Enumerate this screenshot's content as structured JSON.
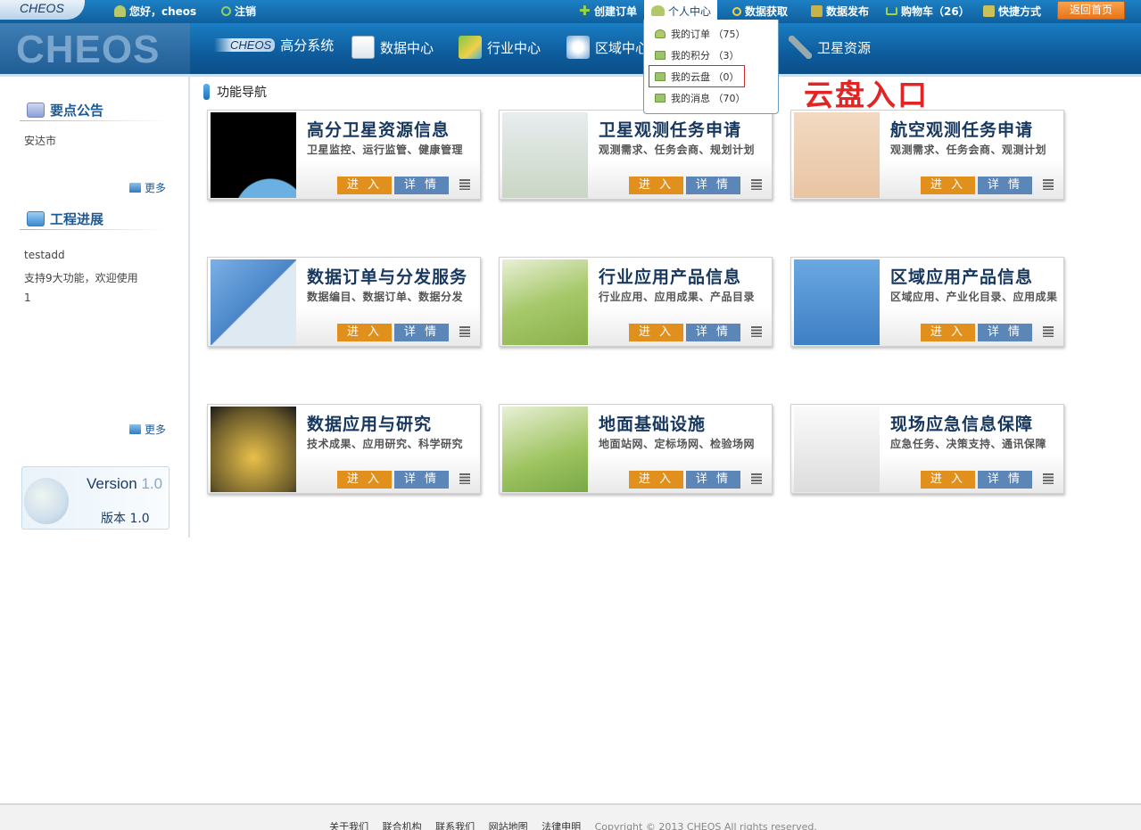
{
  "topbar": {
    "logo_small": "CHEOS",
    "greeting": "您好，cheos",
    "logout": "注销",
    "create_order": "创建订单",
    "personal_center": "个人中心",
    "data_get": "数据获取",
    "data_publish": "数据发布",
    "cart": "购物车（26）",
    "shortcut": "快捷方式",
    "home": "返回首页"
  },
  "header": {
    "logo": "CHEOS",
    "nav": [
      {
        "label": "高分系统",
        "prefix": "CHEOS"
      },
      {
        "label": "数据中心"
      },
      {
        "label": "行业中心"
      },
      {
        "label": "区域中心"
      },
      {
        "label": "卫星资源"
      }
    ]
  },
  "dropdown": {
    "items": [
      {
        "label": "我的订单 （75）"
      },
      {
        "label": "我的积分 （3）"
      },
      {
        "label": "我的云盘 （0）"
      },
      {
        "label": "我的消息 （70）"
      }
    ]
  },
  "annotation": "云盘入口",
  "sidebar": {
    "notice_title": "要点公告",
    "notice_items": [
      "安达市"
    ],
    "more1": "更多",
    "progress_title": "工程进展",
    "progress_items": [
      "testadd",
      "支持9大功能，欢迎使用",
      "1"
    ],
    "more2": "更多",
    "version_label": "Version",
    "version_num": "1.0",
    "version_cn": "版本  1.0"
  },
  "main": {
    "title": "功能导航",
    "cards": [
      {
        "title": "高分卫星资源信息",
        "subtitle": "卫星监控、运行监管、健康管理"
      },
      {
        "title": "卫星观测任务申请",
        "subtitle": "观测需求、任务会商、规划计划"
      },
      {
        "title": "航空观测任务申请",
        "subtitle": "观测需求、任务会商、观测计划"
      },
      {
        "title": "数据订单与分发服务",
        "subtitle": "数据编目、数据订单、数据分发"
      },
      {
        "title": "行业应用产品信息",
        "subtitle": "行业应用、应用成果、产品目录"
      },
      {
        "title": "区域应用产品信息",
        "subtitle": "区域应用、产业化目录、应用成果"
      },
      {
        "title": "数据应用与研究",
        "subtitle": "技术成果、应用研究、科学研究"
      },
      {
        "title": "地面基础设施",
        "subtitle": "地面站网、定标场网、检验场网"
      },
      {
        "title": "现场应急信息保障",
        "subtitle": "应急任务、决策支持、通讯保障"
      }
    ],
    "enter_label": "进 入",
    "detail_label": "详 情"
  },
  "footer": {
    "links": [
      "关于我们",
      "联合机构",
      "联系我们",
      "网站地图",
      "法律申明"
    ],
    "copyright": "Copyright © 2013 CHEOS All rights reserved."
  },
  "colors": {
    "brand_blue": "#0e5c9c",
    "accent_orange": "#e1901e",
    "detail_blue": "#5c85b8",
    "annotation_red": "#e32424"
  }
}
